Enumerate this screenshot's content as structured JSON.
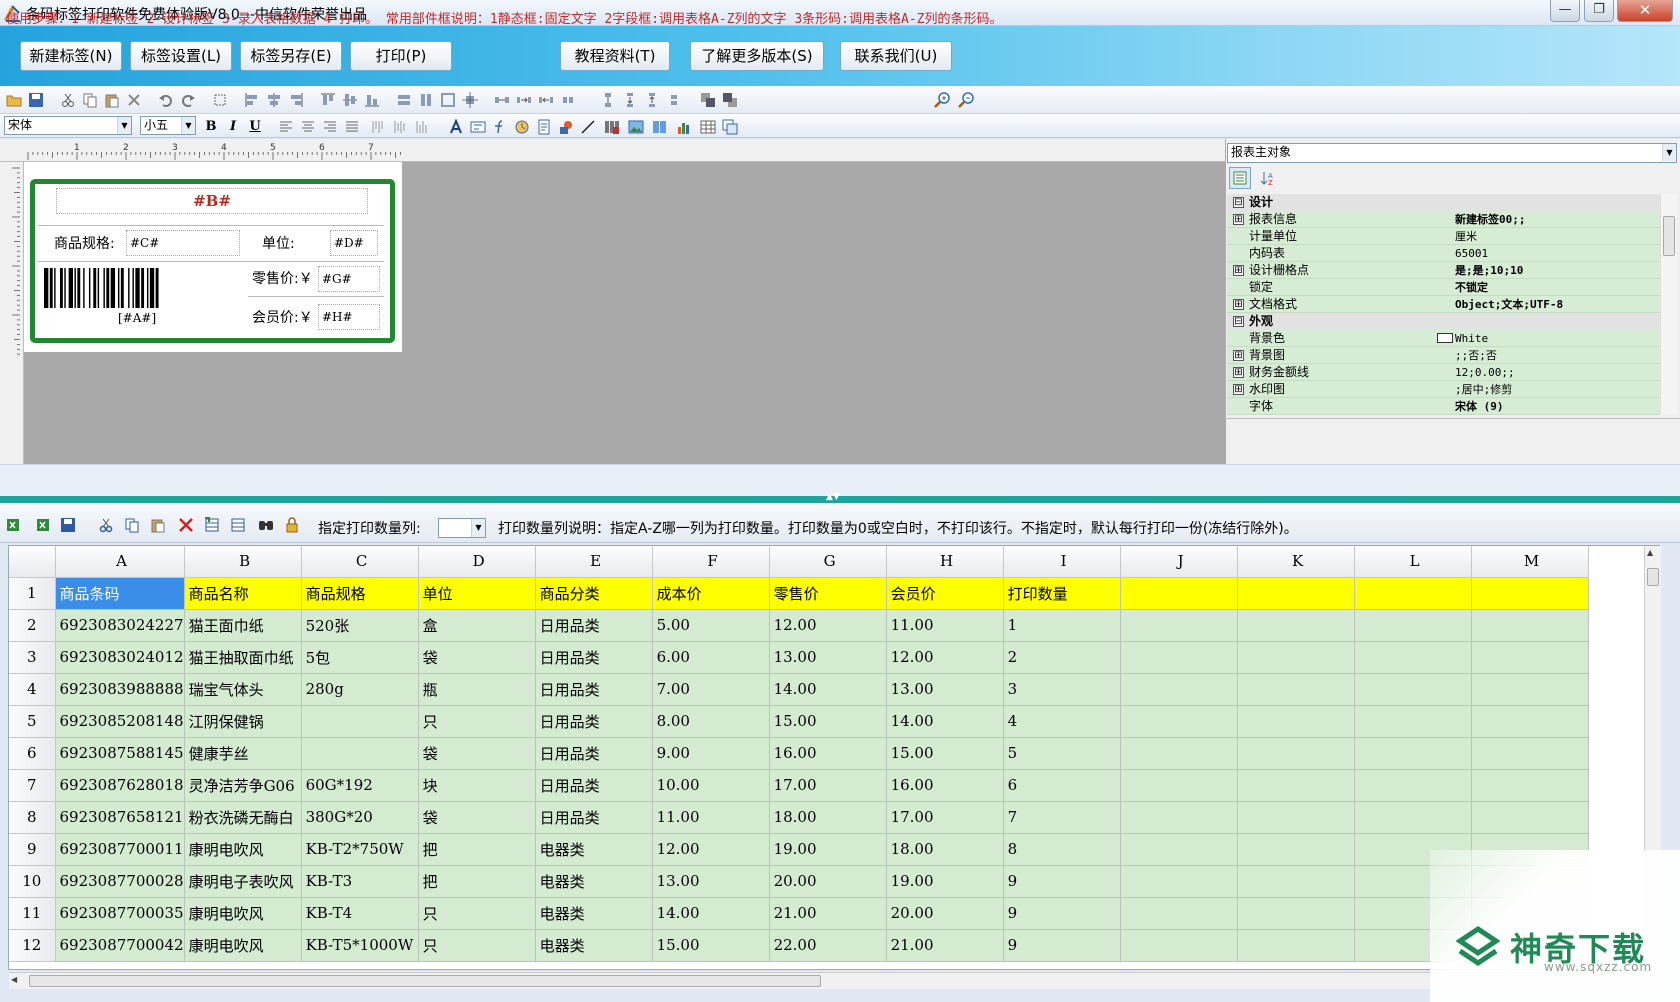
{
  "window": {
    "title": "条码标签打印软件免费体验版V8.0---中信软件荣誉出品",
    "minimize": "—",
    "maximize": "❐",
    "close": "✕"
  },
  "main_buttons": {
    "new_label": "新建标签(N)",
    "label_settings": "标签设置(L)",
    "save_as": "标签另存(E)",
    "print": "打印(P)",
    "tutorial": "教程资料(T)",
    "more_versions": "了解更多版本(S)",
    "contact": "联系我们(U)"
  },
  "format_bar": {
    "font": "宋体",
    "size": "小五",
    "bold": "B",
    "italic": "I",
    "underline": "U"
  },
  "label_design": {
    "title_field": "#B#",
    "spec_label": "商品规格:",
    "spec_field": "#C#",
    "unit_label": "单位:",
    "unit_field": "#D#",
    "retail_label": "零售价:￥",
    "retail_field": "#G#",
    "barcode_text": "[#A#]",
    "member_label": "会员价:￥",
    "member_field": "#H#"
  },
  "ruler_numbers": [
    "1",
    "2",
    "3",
    "4",
    "5",
    "6",
    "7"
  ],
  "properties": {
    "object_selector": "报表主对象",
    "rows": [
      {
        "type": "cat",
        "expander": "⊟",
        "key": "设计",
        "value": ""
      },
      {
        "type": "item",
        "expander": "⊞",
        "key": "报表信息",
        "value": "新建标签00;;"
      },
      {
        "type": "item",
        "expander": "",
        "key": "计量单位",
        "value": "厘米"
      },
      {
        "type": "item",
        "expander": "",
        "key": "内码表",
        "value": "65001"
      },
      {
        "type": "item",
        "expander": "⊞",
        "key": "设计栅格点",
        "value": "是;是;10;10"
      },
      {
        "type": "item",
        "expander": "",
        "key": "锁定",
        "value": "不锁定"
      },
      {
        "type": "item",
        "expander": "⊞",
        "key": "文档格式",
        "value": "Object;文本;UTF-8"
      },
      {
        "type": "cat",
        "expander": "⊟",
        "key": "外观",
        "value": ""
      },
      {
        "type": "item",
        "expander": "",
        "key": "背景色",
        "value": "White"
      },
      {
        "type": "item",
        "expander": "⊞",
        "key": "背景图",
        "value": ";;否;否"
      },
      {
        "type": "item",
        "expander": "⊞",
        "key": "财务金额线",
        "value": "12;0.00;;"
      },
      {
        "type": "item",
        "expander": "⊞",
        "key": "水印图",
        "value": ";居中;修剪"
      },
      {
        "type": "item",
        "expander": "",
        "key": "字体",
        "value": "宋体 (9)"
      }
    ]
  },
  "steps_text": "使用步骤：1-新建标签 2-设计标签 3-录入表格数据 4-打印。 常用部件框说明：1静态框:固定文字 2字段框:调用表格A-Z列的文字 3条形码:调用表格A-Z列的条形码。",
  "grid_toolbar": {
    "print_qty_label": "指定打印数量列:",
    "print_qty_note": "打印数量列说明：指定A-Z哪一列为打印数量。打印数量为0或空白时，不打印该行。不指定时，默认每行打印一份(冻结行除外)。"
  },
  "sheet": {
    "columns": [
      "",
      "A",
      "B",
      "C",
      "D",
      "E",
      "F",
      "G",
      "H",
      "I",
      "J",
      "K",
      "L",
      "M"
    ],
    "field_row": [
      "1",
      "商品条码",
      "商品名称",
      "商品规格",
      "单位",
      "商品分类",
      "成本价",
      "零售价",
      "会员价",
      "打印数量",
      "",
      "",
      "",
      ""
    ],
    "rows": [
      [
        "2",
        "6923083024227",
        "猫王面巾纸",
        "520张",
        "盒",
        "日用品类",
        "5.00",
        "12.00",
        "11.00",
        "1",
        "",
        "",
        "",
        ""
      ],
      [
        "3",
        "6923083024012",
        "猫王抽取面巾纸",
        "5包",
        "袋",
        "日用品类",
        "6.00",
        "13.00",
        "12.00",
        "2",
        "",
        "",
        "",
        ""
      ],
      [
        "4",
        "6923083988888",
        "瑞宝气体头",
        "280g",
        "瓶",
        "日用品类",
        "7.00",
        "14.00",
        "13.00",
        "3",
        "",
        "",
        "",
        ""
      ],
      [
        "5",
        "6923085208148",
        "江阴保健锅",
        "",
        "只",
        "日用品类",
        "8.00",
        "15.00",
        "14.00",
        "4",
        "",
        "",
        "",
        ""
      ],
      [
        "6",
        "6923087588145",
        "健康芋丝",
        "",
        "袋",
        "日用品类",
        "9.00",
        "16.00",
        "15.00",
        "5",
        "",
        "",
        "",
        ""
      ],
      [
        "7",
        "6923087628018",
        "灵净洁芳争G06",
        "60G*192",
        "块",
        "日用品类",
        "10.00",
        "17.00",
        "16.00",
        "6",
        "",
        "",
        "",
        ""
      ],
      [
        "8",
        "6923087658121",
        "粉衣洗磷无酶白",
        "380G*20",
        "袋",
        "日用品类",
        "11.00",
        "18.00",
        "17.00",
        "7",
        "",
        "",
        "",
        ""
      ],
      [
        "9",
        "6923087700011",
        "康明电吹风",
        "KB-T2*750W",
        "把",
        "电器类",
        "12.00",
        "19.00",
        "18.00",
        "8",
        "",
        "",
        "",
        ""
      ],
      [
        "10",
        "6923087700028",
        "康明电子表吹风",
        "KB-T3",
        "把",
        "电器类",
        "13.00",
        "20.00",
        "19.00",
        "9",
        "",
        "",
        "",
        ""
      ],
      [
        "11",
        "6923087700035",
        "康明电吹风",
        "KB-T4",
        "只",
        "电器类",
        "14.00",
        "21.00",
        "20.00",
        "9",
        "",
        "",
        "",
        ""
      ],
      [
        "12",
        "6923087700042",
        "康明电吹风",
        "KB-T5*1000W",
        "只",
        "电器类",
        "15.00",
        "22.00",
        "21.00",
        "9",
        "",
        "",
        "",
        ""
      ]
    ]
  },
  "watermark": {
    "name": "神奇下载",
    "url": "www.sqxzz.com"
  },
  "colors": {
    "label_border": "#1e8a2d",
    "field_row": "#ffff00",
    "data_cell": "#d4ebd2",
    "steps_text": "#c62828"
  }
}
